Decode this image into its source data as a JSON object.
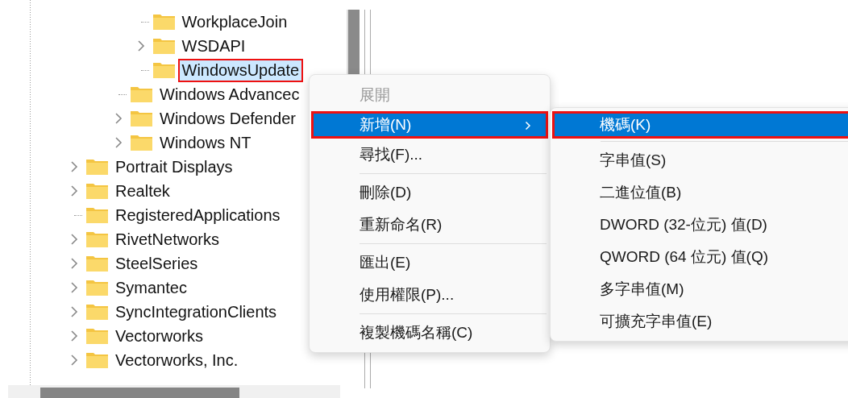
{
  "tree": {
    "items": [
      {
        "children": [
          {
            "children": [
              {
                "children": [
                  {
                    "label": "WorkplaceJoin",
                    "expandable": false,
                    "selected": false,
                    "highlighted": false
                  },
                  {
                    "label": "WSDAPI",
                    "expandable": true,
                    "selected": false,
                    "highlighted": false
                  },
                  {
                    "label": "WindowsUpdate",
                    "expandable": false,
                    "selected": true,
                    "highlighted": true
                  }
                ]
              },
              {
                "label": "Windows Advancec",
                "expandable": false,
                "selected": false,
                "highlighted": false
              },
              {
                "label": "Windows Defender",
                "expandable": true,
                "selected": false,
                "highlighted": false
              },
              {
                "label": "Windows NT",
                "expandable": true,
                "selected": false,
                "highlighted": false
              }
            ]
          }
        ]
      },
      {
        "label": "Portrait Displays",
        "expandable": true,
        "selected": false,
        "highlighted": false
      },
      {
        "label": "Realtek",
        "expandable": true,
        "selected": false,
        "highlighted": false
      },
      {
        "label": "RegisteredApplications",
        "expandable": false,
        "selected": false,
        "highlighted": false
      },
      {
        "label": "RivetNetworks",
        "expandable": true,
        "selected": false,
        "highlighted": false
      },
      {
        "label": "SteelSeries",
        "expandable": true,
        "selected": false,
        "highlighted": false
      },
      {
        "label": "Symantec",
        "expandable": true,
        "selected": false,
        "highlighted": false
      },
      {
        "label": "SyncIntegrationClients",
        "expandable": true,
        "selected": false,
        "highlighted": false
      },
      {
        "label": "Vectorworks",
        "expandable": true,
        "selected": false,
        "highlighted": false
      },
      {
        "label": "Vectorworks, Inc.",
        "expandable": true,
        "selected": false,
        "highlighted": false
      }
    ]
  },
  "context_menu": {
    "items": [
      {
        "kind": "item",
        "label": "展開",
        "disabled": true,
        "selected": false,
        "highlighted": false,
        "submenu": false
      },
      {
        "kind": "item",
        "label": "新增(N)",
        "disabled": false,
        "selected": true,
        "highlighted": true,
        "submenu": true
      },
      {
        "kind": "item",
        "label": "尋找(F)...",
        "disabled": false,
        "selected": false,
        "highlighted": false,
        "submenu": false
      },
      {
        "kind": "separator"
      },
      {
        "kind": "item",
        "label": "刪除(D)",
        "disabled": false,
        "selected": false,
        "highlighted": false,
        "submenu": false
      },
      {
        "kind": "item",
        "label": "重新命名(R)",
        "disabled": false,
        "selected": false,
        "highlighted": false,
        "submenu": false
      },
      {
        "kind": "separator"
      },
      {
        "kind": "item",
        "label": "匯出(E)",
        "disabled": false,
        "selected": false,
        "highlighted": false,
        "submenu": false
      },
      {
        "kind": "item",
        "label": "使用權限(P)...",
        "disabled": false,
        "selected": false,
        "highlighted": false,
        "submenu": false
      },
      {
        "kind": "separator"
      },
      {
        "kind": "item",
        "label": "複製機碼名稱(C)",
        "disabled": false,
        "selected": false,
        "highlighted": false,
        "submenu": false
      }
    ]
  },
  "submenu": {
    "items": [
      {
        "kind": "item",
        "label": "機碼(K)",
        "disabled": false,
        "selected": true,
        "highlighted": true
      },
      {
        "kind": "separator"
      },
      {
        "kind": "item",
        "label": "字串值(S)",
        "disabled": false,
        "selected": false,
        "highlighted": false
      },
      {
        "kind": "item",
        "label": "二進位值(B)",
        "disabled": false,
        "selected": false,
        "highlighted": false
      },
      {
        "kind": "item",
        "label": "DWORD (32-位元) 值(D)",
        "disabled": false,
        "selected": false,
        "highlighted": false
      },
      {
        "kind": "item",
        "label": "QWORD (64 位元) 值(Q)",
        "disabled": false,
        "selected": false,
        "highlighted": false
      },
      {
        "kind": "item",
        "label": "多字串值(M)",
        "disabled": false,
        "selected": false,
        "highlighted": false
      },
      {
        "kind": "item",
        "label": "可擴充字串值(E)",
        "disabled": false,
        "selected": false,
        "highlighted": false
      }
    ]
  }
}
